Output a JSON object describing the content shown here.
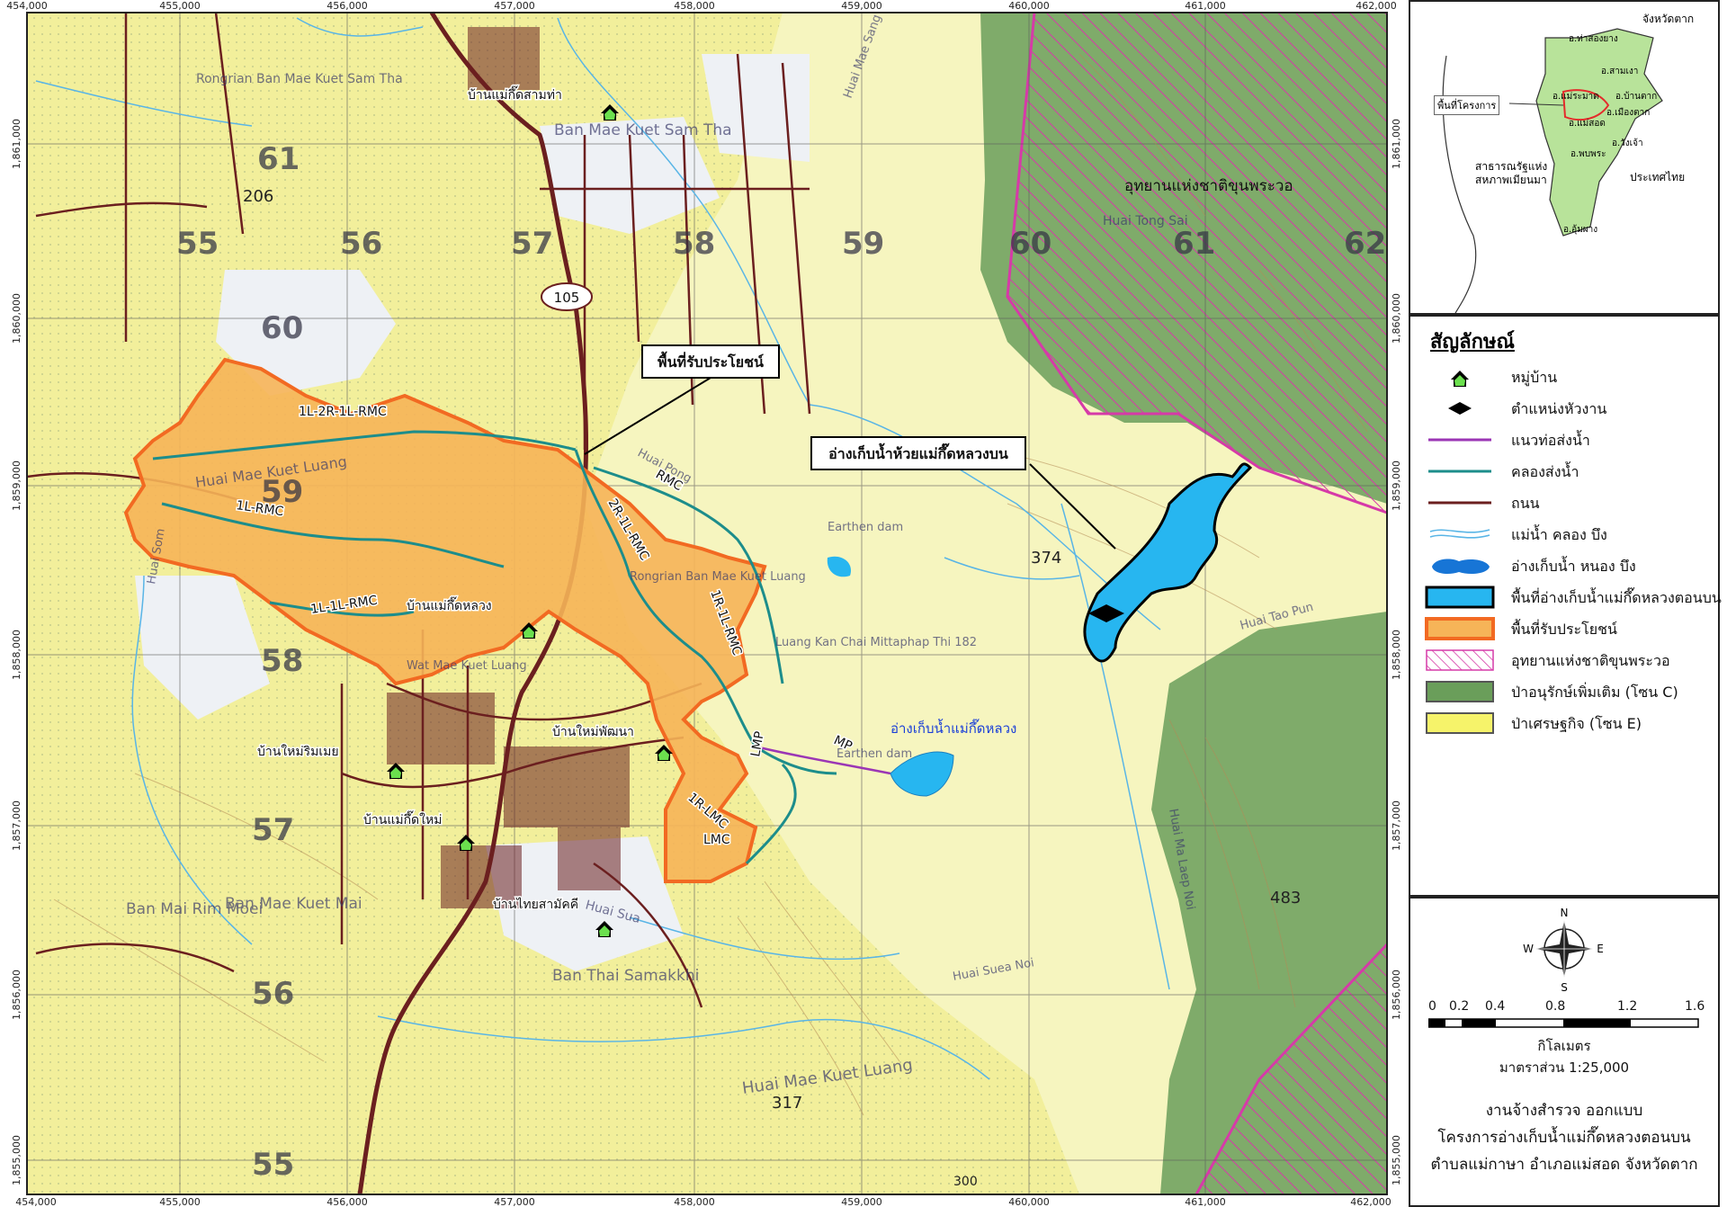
{
  "map": {
    "x_ticks": [
      "454,000",
      "455,000",
      "456,000",
      "457,000",
      "458,000",
      "459,000",
      "460,000",
      "461,000",
      "462,000"
    ],
    "y_ticks": [
      "1,861,000",
      "1,860,000",
      "1,859,000",
      "1,858,000",
      "1,857,000",
      "1,856,000",
      "1,855,000"
    ],
    "grid_labels": [
      {
        "text": "61",
        "row": "top"
      },
      {
        "text": "55",
        "row": "top"
      },
      {
        "text": "56",
        "row": "top"
      },
      {
        "text": "57",
        "row": "top"
      },
      {
        "text": "58",
        "row": "top"
      },
      {
        "text": "59",
        "row": "top"
      },
      {
        "text": "60",
        "row": "top"
      },
      {
        "text": "61",
        "row": "top"
      },
      {
        "text": "62",
        "row": "top"
      },
      {
        "text": "60",
        "row": "left"
      },
      {
        "text": "59",
        "row": "left"
      },
      {
        "text": "58",
        "row": "left"
      },
      {
        "text": "57",
        "row": "left"
      },
      {
        "text": "56",
        "row": "left"
      },
      {
        "text": "55",
        "row": "left"
      }
    ],
    "elevations": [
      "206",
      "374",
      "483",
      "317",
      "300"
    ],
    "road_number": "105",
    "villages": [
      "บ้านแม่กึ๊ดสามท่า",
      "บ้านแม่กึ๊ดหลวง",
      "บ้านใหม่พัฒนา",
      "บ้านใหม่ริมเมย",
      "บ้านแม่กึ๊ดใหม่",
      "บ้านไทยสามัคคี"
    ],
    "place_labels": [
      "Rongrian Ban Mae Kuet Sam Tha",
      "Ban Mae Kuet Sam Tha",
      "Ban Mai Rim Moei",
      "Ban Mae Kuet Mai",
      "Ban Thai Samakkhi",
      "Huai Mae Kuet Luang",
      "Huai Mae Kuet Luang",
      "Huai Pong",
      "Huai Som",
      "Huai Sua",
      "Huai Suea Noi",
      "Huai Ma Laep Noi",
      "Huai Tong Sai",
      "Huai Mae Sang",
      "Huai Tao Pun",
      "Earthen dam",
      "Earthen dam",
      "Wat Mae Kuet Luang",
      "Rongrian Ban Mae Kuet Luang",
      "Luang Kan Chai Mittaphap Thi 182"
    ],
    "canal_labels": [
      "1L-2R-1L-RMC",
      "1L-RMC",
      "1L-1L-RMC",
      "2R-1L-RMC",
      "RMC",
      "1R-1L-RMC",
      "LMP",
      "MP",
      "1R-LMC",
      "LMC"
    ],
    "callouts": {
      "benefit_area": "พื้นที่รับประโยชน์",
      "upper_reservoir": "อ่างเก็บน้ำห้วยแม่กึ๊ดหลวงบน",
      "existing_reservoir": "อ่างเก็บน้ำแม่กึ๊ดหลวง",
      "national_park": "อุทยานแห่งชาติขุนพระวอ"
    }
  },
  "inset": {
    "province": "จังหวัดตาก",
    "project_area": "พื้นที่โครงการ",
    "districts": [
      "อ.ท่าสองยาง",
      "อ.สามเงา",
      "อ.แม่ระมาด",
      "อ.บ้านตาก",
      "อ.เมืองตาก",
      "อ.แม่สอด",
      "อ.วังเจ้า",
      "อ.พบพระ",
      "อ.อุ้มผาง"
    ],
    "country_left": "สาธารณรัฐแห่งสหภาพเมียนมา",
    "country_right": "ประเทศไทย"
  },
  "legend": {
    "title": "สัญลักษณ์",
    "items": [
      {
        "label": "หมู่บ้าน",
        "icon": "village-house-icon"
      },
      {
        "label": "ตำแหน่งหัวงาน",
        "icon": "diamond-icon"
      },
      {
        "label": "แนวท่อส่งน้ำ",
        "icon": "pipe-line-icon"
      },
      {
        "label": "คลองส่งน้ำ",
        "icon": "canal-line-icon"
      },
      {
        "label": "ถนน",
        "icon": "road-line-icon"
      },
      {
        "label": "แม่น้ำ คลอง บึง",
        "icon": "river-line-icon"
      },
      {
        "label": "อ่างเก็บน้ำ หนอง บึง",
        "icon": "reservoir-icon"
      },
      {
        "label": "พื้นที่อ่างเก็บน้ำแม่กึ๊ดหลวงตอนบน",
        "icon": "upper-reservoir-area-icon"
      },
      {
        "label": "พื้นที่รับประโยชน์",
        "icon": "benefit-area-icon"
      },
      {
        "label": "อุทยานแห่งชาติขุนพระวอ",
        "icon": "national-park-hatch-icon"
      },
      {
        "label": "ป่าอนุรักษ์เพิ่มเติม (โซน C)",
        "icon": "zone-c-icon"
      },
      {
        "label": "ป่าเศรษฐกิจ (โซน E)",
        "icon": "zone-e-icon"
      }
    ]
  },
  "north_arrow": {
    "n": "N",
    "s": "S",
    "e": "E",
    "w": "W"
  },
  "scale": {
    "ticks": [
      "0",
      "0.2",
      "0.4",
      "0.8",
      "1.2",
      "1.6"
    ],
    "unit": "กิโลเมตร",
    "ratio": "มาตราส่วน 1:25,000"
  },
  "title_block": {
    "line1": "งานจ้างสำรวจ ออกแบบ",
    "line2": "โครงการอ่างเก็บน้ำแม่กึ๊ดหลวงตอนบน",
    "line3": "ตำบลแม่กาษา อำเภอแม่สอด จังหวัดตาก"
  },
  "colors": {
    "zone_e": "#f3f08d",
    "zone_c": "#6a9e5a",
    "benefit": "#f6b458",
    "benefit_edge": "#f26a22",
    "reservoir": "#27b6f0",
    "park": "#d63aa8",
    "canal": "#1d8d8b",
    "road": "#6b1f1f",
    "river": "#59b5e6"
  }
}
